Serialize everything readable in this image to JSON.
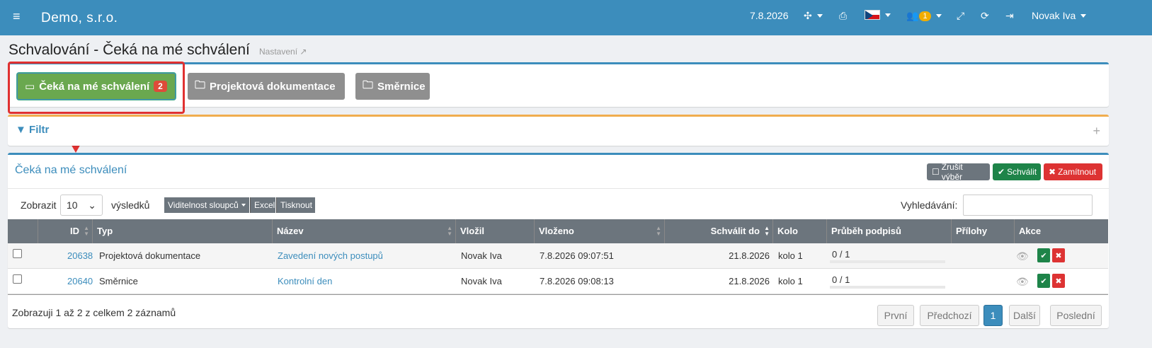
{
  "topbar": {
    "menu_icon": "hamburger-icon",
    "brand": "Demo, s.r.o.",
    "date": "7.8.2026",
    "puzzle_icon": "puzzle-icon",
    "print_icon": "print-icon",
    "lang_icon": "czech-flag-icon",
    "users_icon": "users-icon",
    "users_badge": "1",
    "expand_icon": "fullscreen-icon",
    "refresh_icon": "refresh-icon",
    "logout_icon": "sign-out-icon",
    "user": "Novak Iva"
  },
  "page": {
    "title": "Schvalování - Čeká na mé schválení",
    "settings": "Nastavení"
  },
  "tabs": [
    {
      "label": "Čeká na mé schválení",
      "badge": "2"
    },
    {
      "label": "Projektová dokumentace"
    },
    {
      "label": "Směrnice"
    }
  ],
  "filter": {
    "label": "Filtr",
    "expand": "+"
  },
  "list": {
    "title": "Čeká na mé schválení",
    "clear_selection": "Zrušit výběr",
    "approve": "Schválit",
    "reject": "Zamítnout",
    "show_label": "Zobrazit",
    "page_size": "10",
    "results_label": "výsledků",
    "col_visibility": "Viditelnost sloupců",
    "excel": "Excel",
    "print": "Tisknout",
    "search_label": "Vyhledávání:",
    "search_value": ""
  },
  "table": {
    "headers": [
      "ID",
      "Typ",
      "Název",
      "Vložil",
      "Vloženo",
      "Schválit do",
      "Kolo",
      "Průběh podpisů",
      "Přílohy",
      "Akce"
    ],
    "rows": [
      {
        "id": "20638",
        "type": "Projektová dokumentace",
        "name": "Zavedení nových postupů",
        "author": "Novak Iva",
        "inserted": "7.8.2026 09:07:51",
        "deadline": "21.8.2026",
        "round": "kolo 1",
        "progress": "0 / 1",
        "progress_fraction": 0
      },
      {
        "id": "20640",
        "type": "Směrnice",
        "name": "Kontrolní den",
        "author": "Novak Iva",
        "inserted": "7.8.2026 09:08:13",
        "deadline": "21.8.2026",
        "round": "kolo 1",
        "progress": "0 / 1",
        "progress_fraction": 0
      }
    ]
  },
  "footer": {
    "info": "Zobrazuji 1 až 2 z celkem 2 záznamů",
    "first": "První",
    "prev": "Předchozí",
    "current": "1",
    "next": "Další",
    "last": "Poslední"
  },
  "colors": {
    "header": "#3c8dbc",
    "active_tab": "#6aa84f",
    "highlight": "#e03131"
  }
}
